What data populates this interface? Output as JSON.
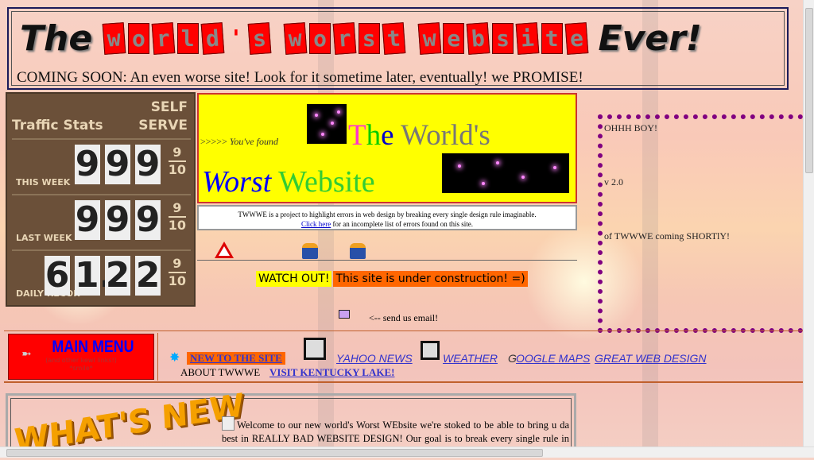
{
  "header": {
    "logo_the": "The",
    "logo_tiles": [
      "w",
      "o",
      "r",
      "l",
      "d",
      "'",
      "s",
      " ",
      "w",
      "o",
      "r",
      "s",
      "t",
      " ",
      "w",
      "e",
      "b",
      "s",
      "i",
      "t",
      "e"
    ],
    "logo_ever": "Ever!",
    "coming_soon": "COMING SOON: An even worse site! Look for it sometime later, eventually!  we PROMISE!"
  },
  "stats": {
    "title": "Traffic Stats",
    "self": "SELF",
    "serve": "SERVE",
    "rows": [
      {
        "label": "THIS WEEK",
        "digits": [
          "9",
          "9",
          "9"
        ]
      },
      {
        "label": "LAST WEEK",
        "digits": [
          "9",
          "9",
          "9"
        ]
      },
      {
        "label": "DAILY RECOR",
        "digits": [
          "6",
          "1.",
          "2",
          "2"
        ]
      }
    ],
    "frac_num": "9",
    "frac_den": "10"
  },
  "banner": {
    "prefix": ">>>>> ",
    "found": "You've found",
    "the_T": "T",
    "the_h": "h",
    "the_e": "e",
    "worlds": " World's",
    "worst": "Worst",
    "website": " Website"
  },
  "desc": {
    "line1": "TWWWE is a project to highlight errors in web design by breaking every single design rule imaginable.",
    "link": "Click here",
    "line2": " for an incomplete list of errors found on this site."
  },
  "construction": {
    "watch": "WATCH OUT!",
    "under": "This site is under construction! =)",
    "email": "<-- send us email!"
  },
  "side": {
    "line1": "OHHH BOY!",
    "line2": "v 2.0",
    "line3": "of TWWWE coming SHORTlY!"
  },
  "menu": {
    "title": "MAIN MENU",
    "sub1": "(and other kewl links!)",
    "sub2": "*smile*",
    "new_badge": "NEW",
    "links": {
      "new_site": "NEW TO THE SITE",
      "yahoo": "YAHOO NEWS",
      "weather": "WEATHER",
      "google_g": "G",
      "google": "OOGLE MAPS",
      "great": "GREAT WEB DESIGN",
      "about": "ABOUT TWWWE",
      "kentucky": "VISIT KENTUCKY LAKE!"
    }
  },
  "whats_new": {
    "title": "WHAT'S NEW",
    "text": "Welcome to our new world's Worst WEbsite              we're stoked to be able to bring u da best in REALLY BAD WEBSITE DESIGN!  Our goal is to break every single rule in website deign!!!      As an educational tool, the aim of this sight is to"
  }
}
